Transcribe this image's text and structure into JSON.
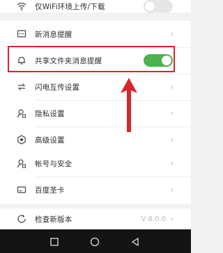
{
  "top_row": {
    "label": "仅WiFi环境上传/下载",
    "toggle_on": false
  },
  "items": [
    {
      "label": "新消息提醒"
    },
    {
      "label": "共享文件夹消息提醒",
      "toggle_on": true
    },
    {
      "label": "闪电互传设置"
    },
    {
      "label": "隐私设置"
    },
    {
      "label": "高级设置"
    },
    {
      "label": "帐号与安全"
    },
    {
      "label": "百度圣卡"
    },
    {
      "label": "检查新版本",
      "version": "V 8.0.0"
    }
  ],
  "colors": {
    "toggle_on": "#4cb14f",
    "toggle_off": "#e6e6e6",
    "highlight": "#d8252a",
    "navbar": "#141414"
  },
  "icons": [
    "wifi-icon",
    "message-icon",
    "bell-icon",
    "transfer-icon",
    "privacy-icon",
    "settings-icon",
    "account-icon",
    "card-icon",
    "update-icon"
  ]
}
